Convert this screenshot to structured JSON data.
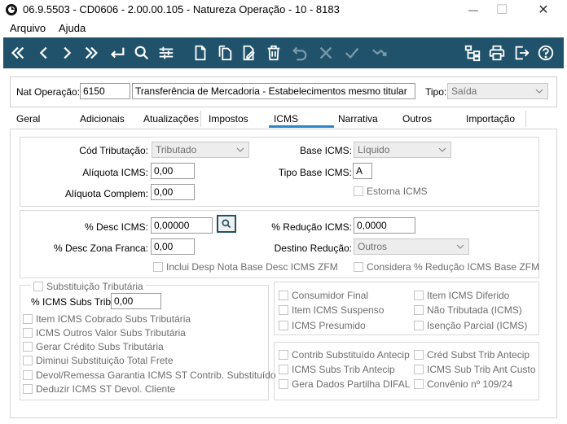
{
  "window": {
    "title": "06.9.5503 - CD0606 - 2.00.00.105 - Natureza Operação - 10 - 8183",
    "minimize": "—",
    "maximize": "☐",
    "close": "✕"
  },
  "menu": {
    "items": [
      "Arquivo",
      "Ajuda"
    ]
  },
  "toolbar": {
    "accent": "#20536b",
    "buttons": [
      "first-icon",
      "previous-icon",
      "next-icon",
      "last-icon",
      "enter-icon",
      "search-icon",
      "filter-icon",
      "new-icon",
      "copy-icon",
      "edit-icon",
      "delete-icon",
      "undo-icon",
      "cancel-icon",
      "confirm-icon",
      "refresh-icon",
      "tree-icon",
      "print-icon",
      "exit-icon",
      "help-icon"
    ]
  },
  "header": {
    "nat_label": "Nat Operação:",
    "nat_code": "6150",
    "nat_desc": "Transferência de Mercadoria - Estabelecimentos mesmo titular",
    "tipo_label": "Tipo:",
    "tipo_value": "Saída"
  },
  "tabs": [
    "Geral",
    "Adicionais",
    "Atualizações",
    "Impostos",
    "ICMS",
    "Narrativa",
    "Outros",
    "Importação"
  ],
  "active_tab": "ICMS",
  "icms": {
    "cod_trib_label": "Cód Tributação:",
    "cod_trib_value": "Tributado",
    "aliquota_label": "Alíquota ICMS:",
    "aliquota_value": "0,00",
    "aliquota_complem_label": "Alíquota Complem:",
    "aliquota_complem_value": "0,00",
    "base_icms_label": "Base ICMS:",
    "base_icms_value": "Líquido",
    "tipo_base_label": "Tipo Base ICMS:",
    "tipo_base_value": "A",
    "estorna_label": "Estorna ICMS",
    "desc_icms_label": "% Desc ICMS:",
    "desc_icms_value": "0,00000",
    "desc_zona_label": "% Desc Zona Franca:",
    "desc_zona_value": "0,00",
    "reducao_label": "% Redução ICMS:",
    "reducao_value": "0,0000",
    "destino_label": "Destino Redução:",
    "destino_value": "Outros",
    "inclui_desp_label": "Inclui Desp Nota Base Desc ICMS ZFM",
    "considera_label": "Considera % Redução ICMS Base ZFM",
    "subst_label": "Substituição Tributária",
    "subs_trib_label": "% ICMS Subs Trib:",
    "subs_trib_value": "0,00",
    "left_checks": [
      "Item ICMS Cobrado Subs Tributária",
      "ICMS Outros Valor Subs Tributária",
      "Gerar Crédito Subs Tributária",
      "Diminui Substituição Total Frete",
      "Devol/Remessa Garantia ICMS ST Contrib. Substituído",
      "Deduzir ICMS ST Devol. Cliente"
    ],
    "right_top_checks": [
      [
        "Consumidor Final",
        "Item ICMS Diferido"
      ],
      [
        "Item ICMS Suspenso",
        "Não Tributada (ICMS)"
      ],
      [
        "ICMS Presumido",
        "Isenção Parcial (ICMS)"
      ]
    ],
    "right_bottom_checks": [
      [
        "Contrib Substituído Antecip",
        "Créd Subst Trib Antecip"
      ],
      [
        "ICMS Subs Trib Antecip",
        "ICMS Sub Trib Ant Custo"
      ],
      [
        "Gera Dados Partilha DIFAL",
        "Convênio nº 109/24"
      ]
    ]
  }
}
